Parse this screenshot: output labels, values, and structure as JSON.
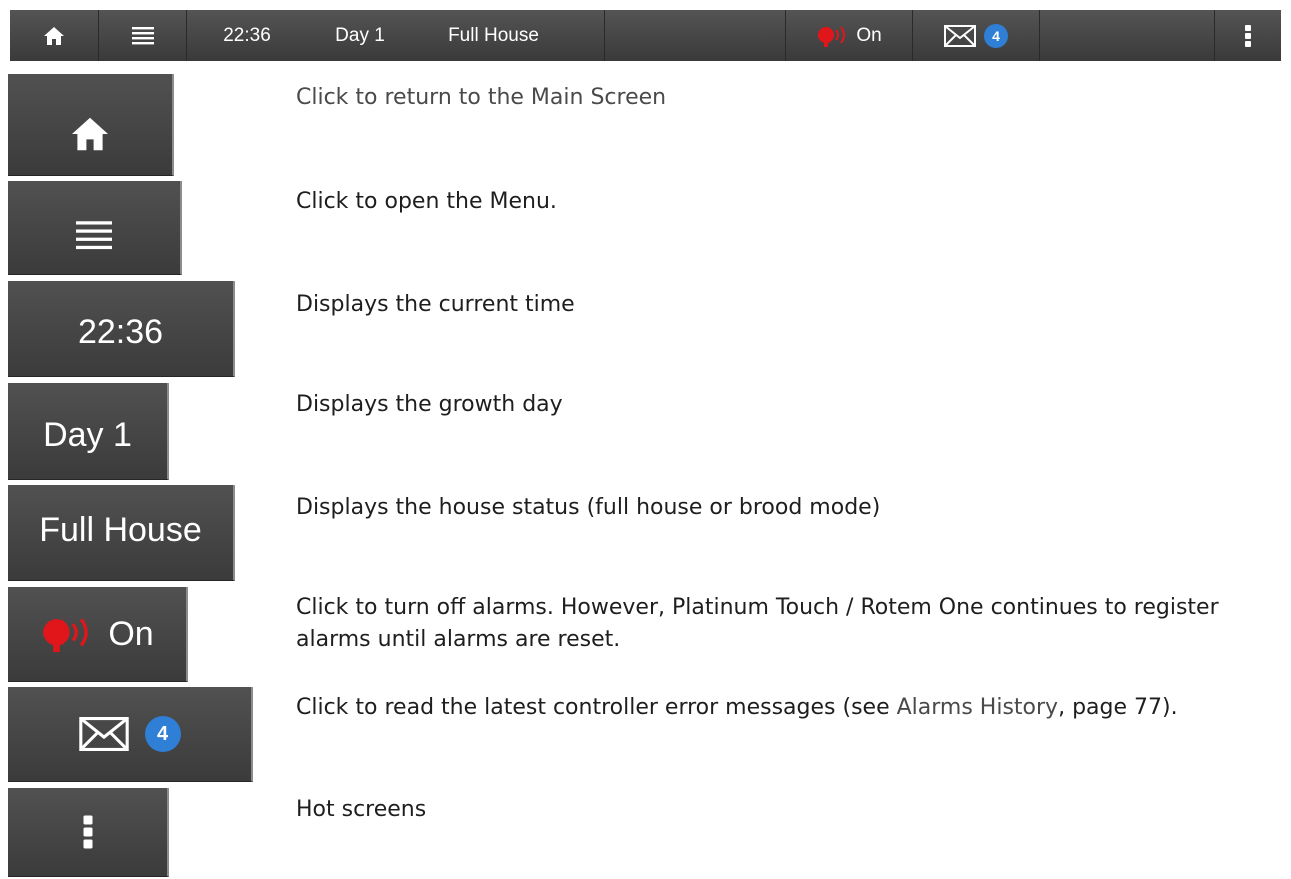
{
  "topbar": {
    "time": "22:36",
    "day": "Day 1",
    "status": "Full House",
    "alarm": "On",
    "messages_count": "4"
  },
  "items": [
    {
      "icon": "home-icon",
      "description": "Click to return to the Main Screen"
    },
    {
      "icon": "menu-icon",
      "description": "Click to open the Menu."
    },
    {
      "label": "22:36",
      "description": "Displays the current time"
    },
    {
      "label": "Day 1",
      "description": "Displays the growth day"
    },
    {
      "label": "Full House",
      "description": "Displays the house status (full house or brood mode)"
    },
    {
      "label": "On",
      "description": "Click to turn off alarms. However, Platinum Touch / Rotem One continues to register alarms until alarms are reset."
    },
    {
      "badge": "4",
      "description_before": "Click to read the latest controller error messages (see ",
      "link": "Alarms History",
      "description_after": ", page 77)."
    },
    {
      "icon": "more-vertical-icon",
      "description": "Hot screens"
    }
  ],
  "colors": {
    "bar": "#454545",
    "badge": "#2f7fd6",
    "alarm": "#e0161b"
  }
}
